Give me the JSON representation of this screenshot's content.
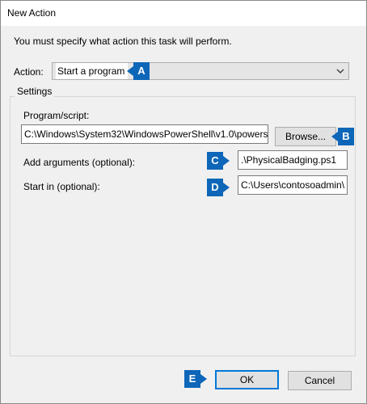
{
  "window": {
    "title": "New Action"
  },
  "instruction": "You must specify what action this task will perform.",
  "action": {
    "label": "Action:",
    "value": "Start a program",
    "icon": "chevron-down-icon"
  },
  "settings": {
    "legend": "Settings",
    "program_label": "Program/script:",
    "program_value": "C:\\Windows\\System32\\WindowsPowerShell\\v1.0\\powers",
    "browse_label": "Browse...",
    "arguments_label": "Add arguments (optional):",
    "arguments_value": ".\\PhysicalBadging.ps1",
    "start_in_label": "Start in (optional):",
    "start_in_value": "C:\\Users\\contosoadmin\\"
  },
  "buttons": {
    "ok": "OK",
    "cancel": "Cancel"
  },
  "callouts": {
    "a": "A",
    "b": "B",
    "c": "C",
    "d": "D",
    "e": "E"
  },
  "colors": {
    "callout": "#0e66b8",
    "focus_border": "#0078d7"
  }
}
